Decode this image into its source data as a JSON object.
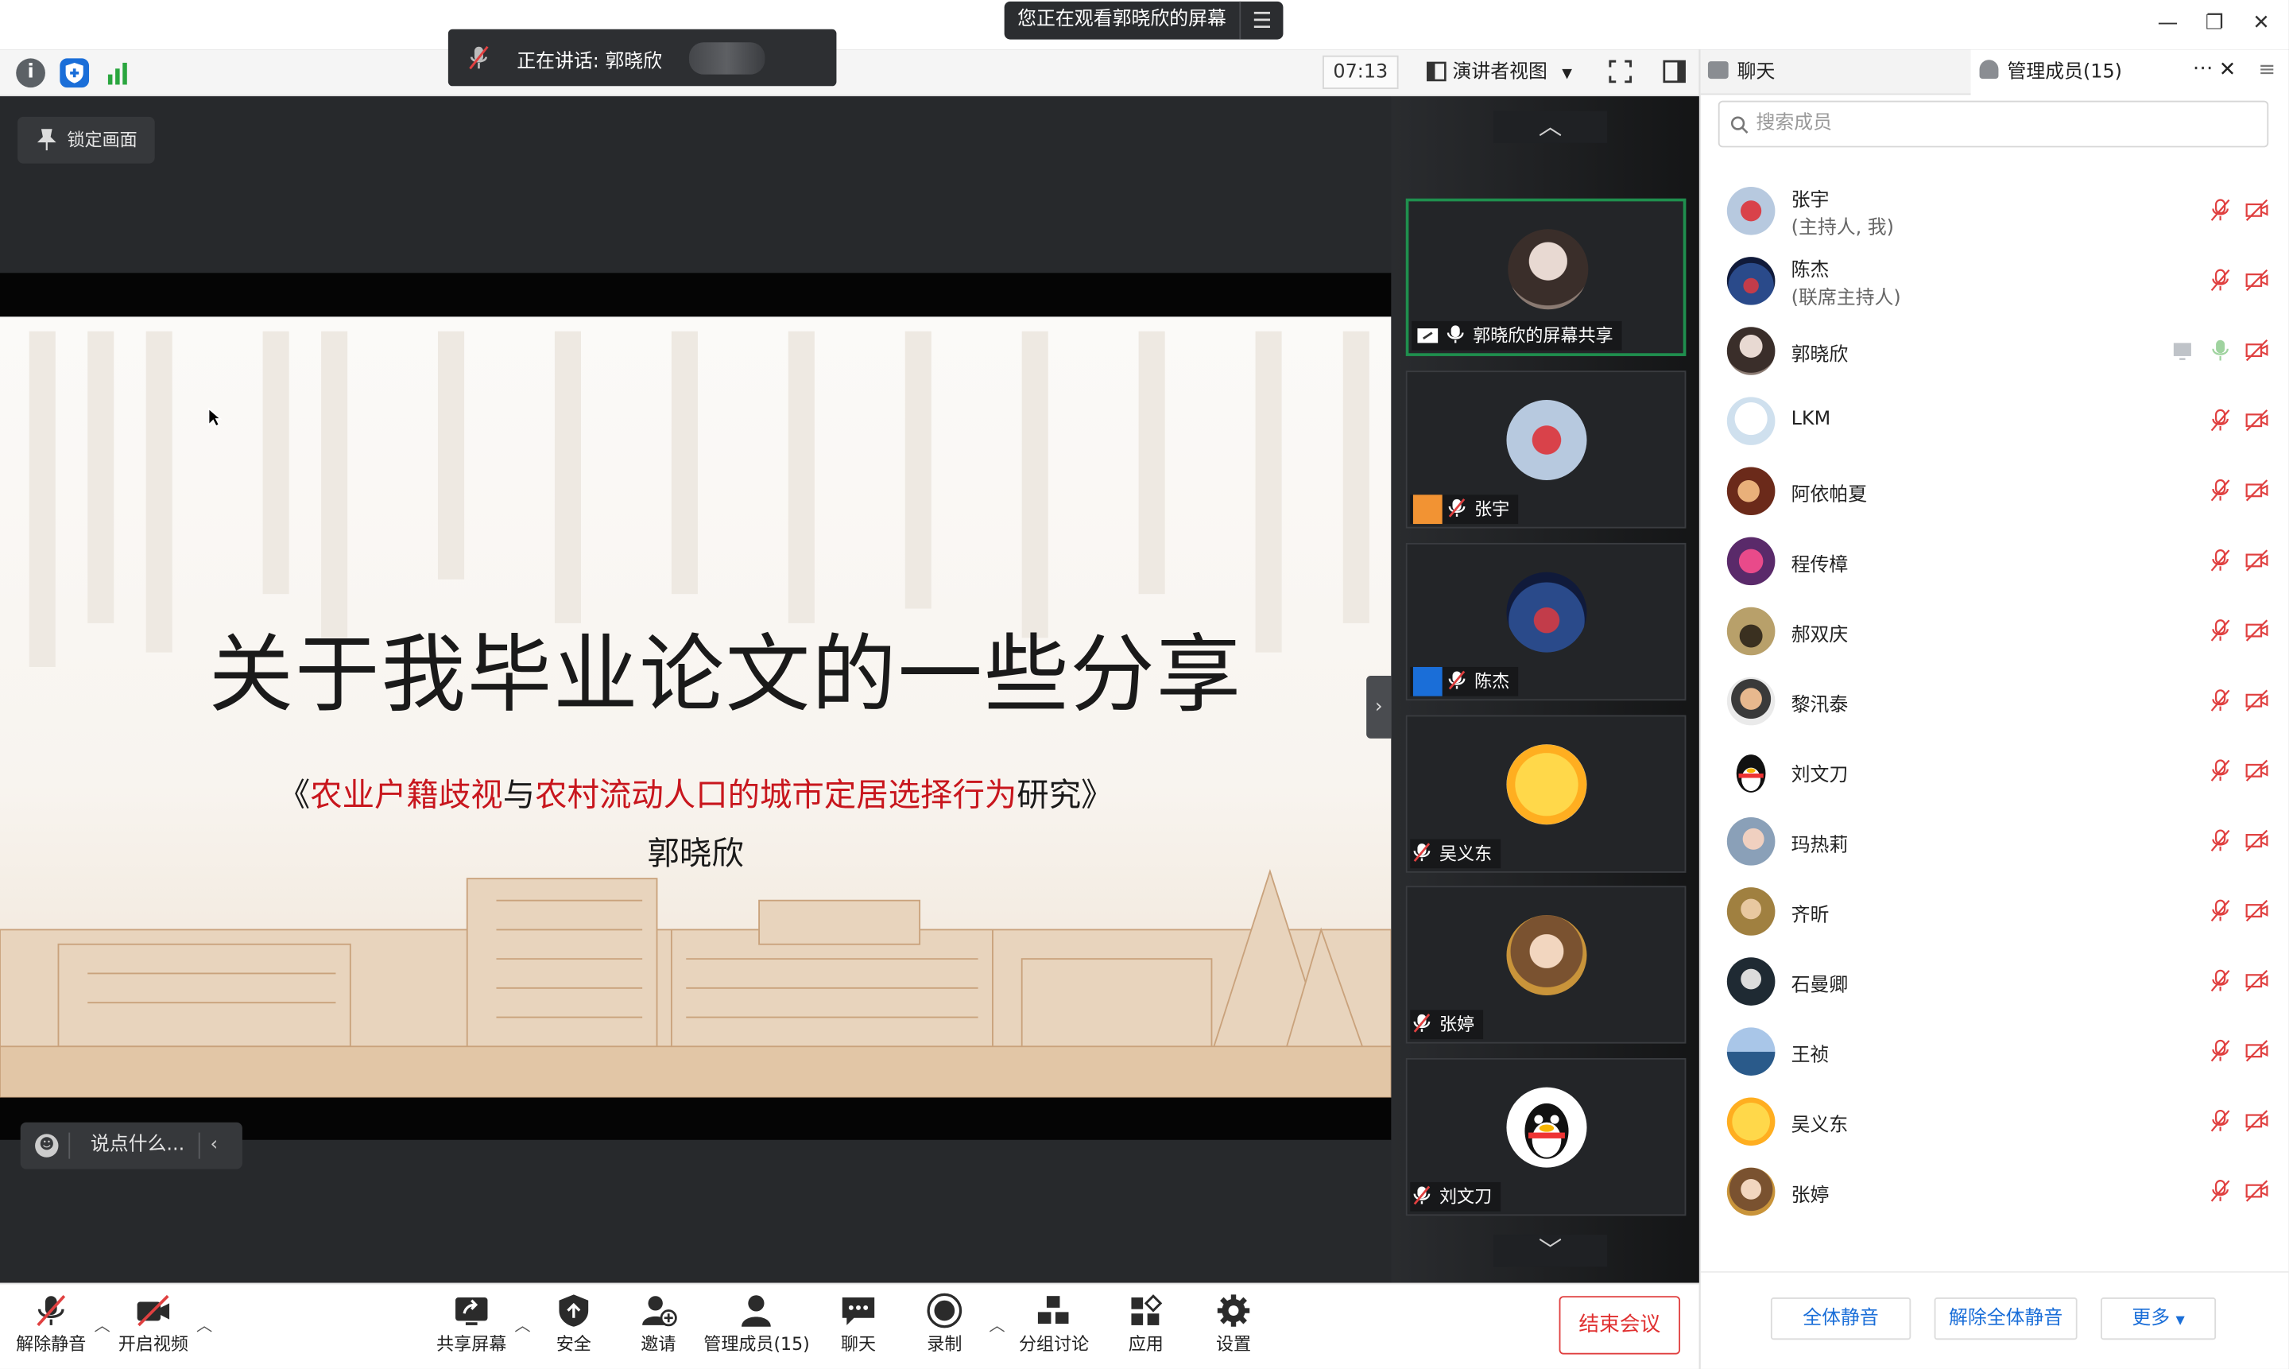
{
  "screen_share_banner": {
    "text": "您正在观看郭晓欣的屏幕",
    "menu_icon": "list-icon"
  },
  "speaking": {
    "label": "正在讲话: 郭晓欣"
  },
  "toolbar": {
    "timer": "07:13",
    "view_mode": "演讲者视图"
  },
  "main_video": {
    "lock_screen_label": "锁定画面",
    "chat_placeholder": "说点什么...",
    "slide": {
      "title": "关于我毕业论文的一些分享",
      "subtitle_open": "《",
      "subtitle_red1": "农业户籍歧视",
      "subtitle_mid": "与",
      "subtitle_red2": "农村流动人口的城市定居选择行为",
      "subtitle_end": "研究》",
      "author": "郭晓欣"
    }
  },
  "gallery": {
    "tiles": [
      {
        "name": "郭晓欣的屏幕共享"
      },
      {
        "name": "张宇"
      },
      {
        "name": "陈杰"
      },
      {
        "name": "吴义东"
      },
      {
        "name": "张婷"
      },
      {
        "name": "刘文刀"
      }
    ]
  },
  "panel": {
    "tab_chat": "聊天",
    "tab_members": "管理成员(15)",
    "more_icon": "ellipsis-icon",
    "search_placeholder": "搜索成员",
    "members": [
      {
        "name": "张宇",
        "role": "(主持人, 我)"
      },
      {
        "name": "陈杰",
        "role": "(联席主持人)"
      },
      {
        "name": "郭晓欣",
        "role": ""
      },
      {
        "name": "LKM",
        "role": ""
      },
      {
        "name": "阿依帕夏",
        "role": ""
      },
      {
        "name": "程传樟",
        "role": ""
      },
      {
        "name": "郝双庆",
        "role": ""
      },
      {
        "name": "黎汛泰",
        "role": ""
      },
      {
        "name": "刘文刀",
        "role": ""
      },
      {
        "name": "玛热莉",
        "role": ""
      },
      {
        "name": "齐昕",
        "role": ""
      },
      {
        "name": "石曼卿",
        "role": ""
      },
      {
        "name": "王祯",
        "role": ""
      },
      {
        "name": "吴义东",
        "role": ""
      },
      {
        "name": "张婷",
        "role": ""
      }
    ],
    "mute_all": "全体静音",
    "unmute_all": "解除全体静音",
    "more": "更多"
  },
  "bottom_toolbar": {
    "unmute": "解除静音",
    "start_video": "开启视频",
    "share_screen": "共享屏幕",
    "security": "安全",
    "invite": "邀请",
    "members": "管理成员(15)",
    "chat": "聊天",
    "record": "录制",
    "breakout": "分组讨论",
    "apps": "应用",
    "settings": "设置",
    "end_meeting": "结束会议"
  },
  "colors": {
    "accent_blue": "#1a6ed8",
    "end_red": "#e03030",
    "slide_red": "#c8161d",
    "active_green": "#1f8f4e"
  }
}
